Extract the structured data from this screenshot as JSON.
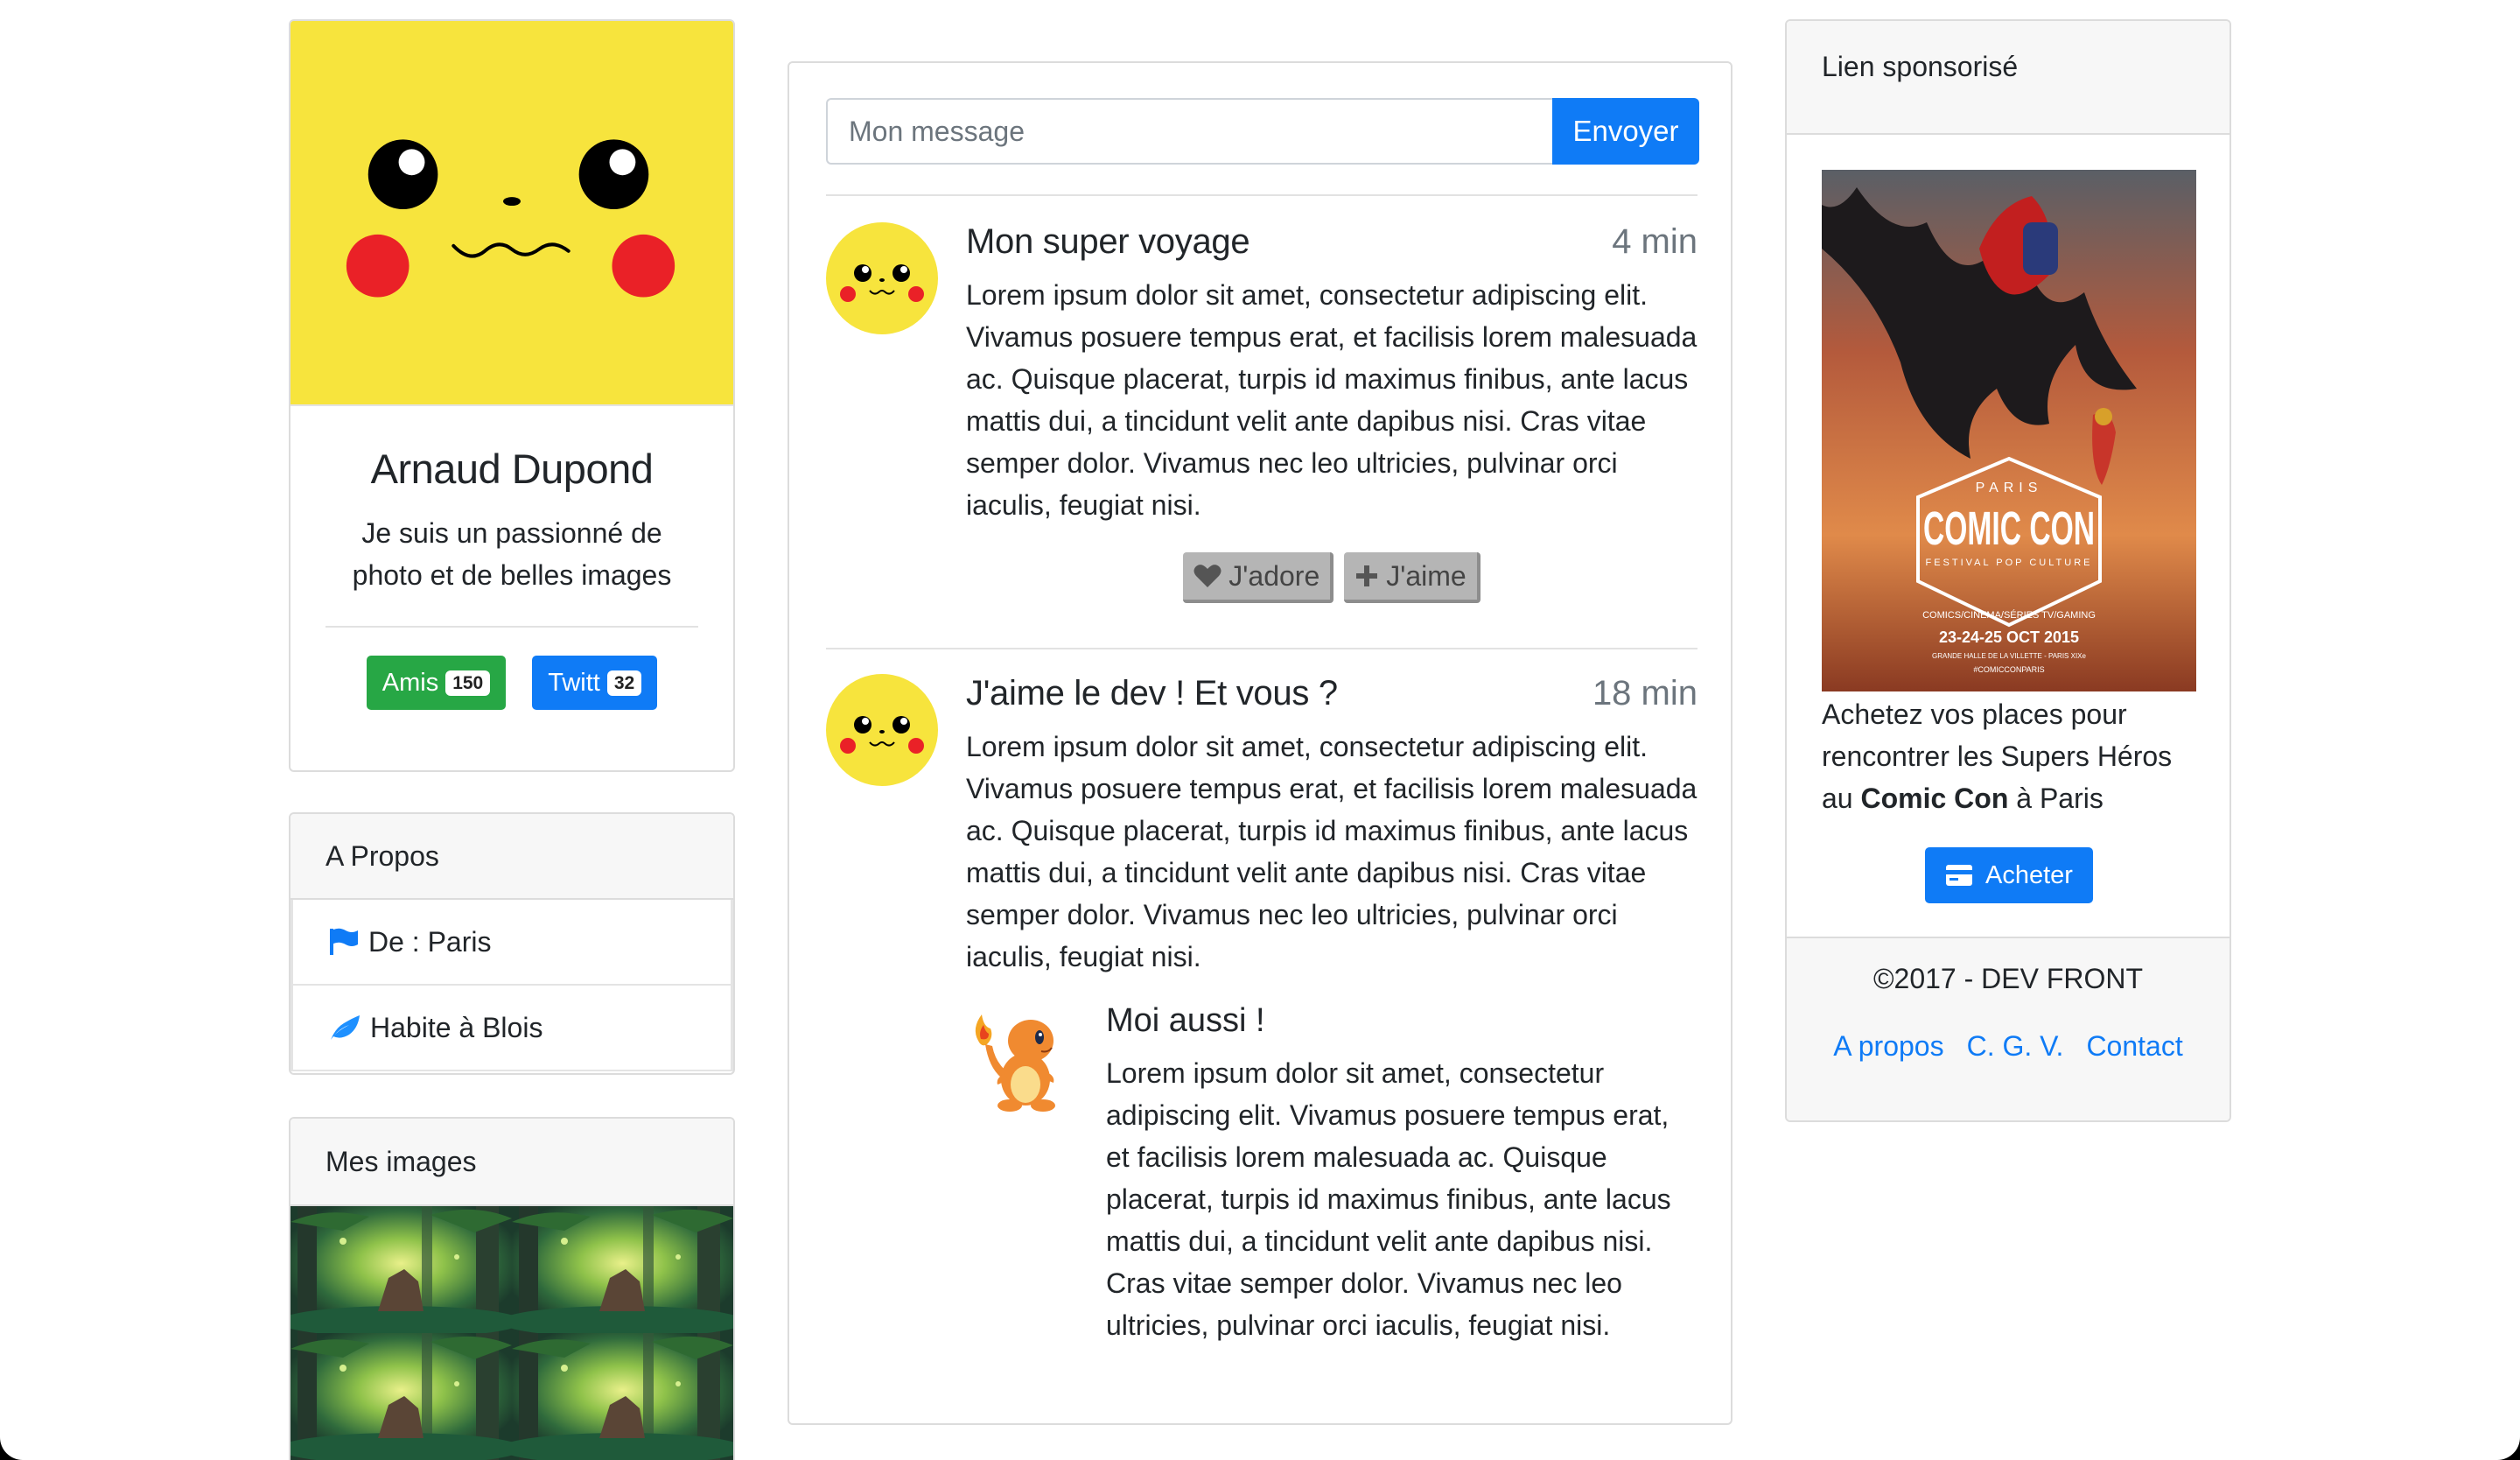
{
  "profile": {
    "name": "Arnaud Dupond",
    "bio": "Je suis un passionné de photo et de belles images",
    "friends_label": "Amis",
    "friends_count": "150",
    "tweets_label": "Twitt",
    "tweets_count": "32"
  },
  "about": {
    "title": "A Propos",
    "items": [
      {
        "icon": "flag-icon",
        "label": "De : Paris"
      },
      {
        "icon": "leaf-icon",
        "label": "Habite à Blois"
      }
    ]
  },
  "images": {
    "title": "Mes images"
  },
  "composer": {
    "placeholder": "Mon message",
    "send_label": "Envoyer"
  },
  "posts": [
    {
      "title": "Mon super voyage",
      "time": "4 min",
      "text": "Lorem ipsum dolor sit amet, consectetur adipiscing elit. Vivamus posuere tempus erat, et facilisis lorem malesuada ac. Quisque placerat, turpis id maximus finibus, ante lacus mattis dui, a tincidunt velit ante dapibus nisi. Cras vitae semper dolor. Vivamus nec leo ultricies, pulvinar orci iaculis, feugiat nisi.",
      "love_label": "J'adore",
      "like_label": "J'aime"
    },
    {
      "title": "J'aime le dev ! Et vous ?",
      "time": "18 min",
      "text": "Lorem ipsum dolor sit amet, consectetur adipiscing elit. Vivamus posuere tempus erat, et facilisis lorem malesuada ac. Quisque placerat, turpis id maximus finibus, ante lacus mattis dui, a tincidunt velit ante dapibus nisi. Cras vitae semper dolor. Vivamus nec leo ultricies, pulvinar orci iaculis, feugiat nisi.",
      "reply": {
        "title": "Moi aussi !",
        "text": "Lorem ipsum dolor sit amet, consectetur adipiscing elit. Vivamus posuere tempus erat, et facilisis lorem malesuada ac. Quisque placerat, turpis id maximus finibus, ante lacus mattis dui, a tincidunt velit ante dapibus nisi. Cras vitae semper dolor. Vivamus nec leo ultricies, pulvinar orci iaculis, feugiat nisi."
      }
    }
  ],
  "sponsor": {
    "title": "Lien sponsorisé",
    "poster": {
      "city": "PARIS",
      "brand": "COMIC CON",
      "tagline": "FESTIVAL POP CULTURE",
      "categories": "COMICS/CINEMA/SÉRIES TV/GAMING",
      "dates": "23-24-25 OCT 2015",
      "venue": "GRANDE HALLE DE LA VILLETTE - PARIS XIXe",
      "hashtag": "#COMICCONPARIS"
    },
    "text_before": "Achetez vos places pour rencontrer les Supers Héros au ",
    "text_bold": "Comic Con",
    "text_after": " à Paris",
    "buy_label": "Acheter"
  },
  "footer": {
    "copyright": "©2017 - DEV FRONT",
    "links": [
      "A propos",
      "C. G. V.",
      "Contact"
    ]
  },
  "colors": {
    "primary": "#0f7bf6",
    "success": "#27a745",
    "pikachu_yellow": "#f7e43d",
    "cheek_red": "#ea2127"
  }
}
